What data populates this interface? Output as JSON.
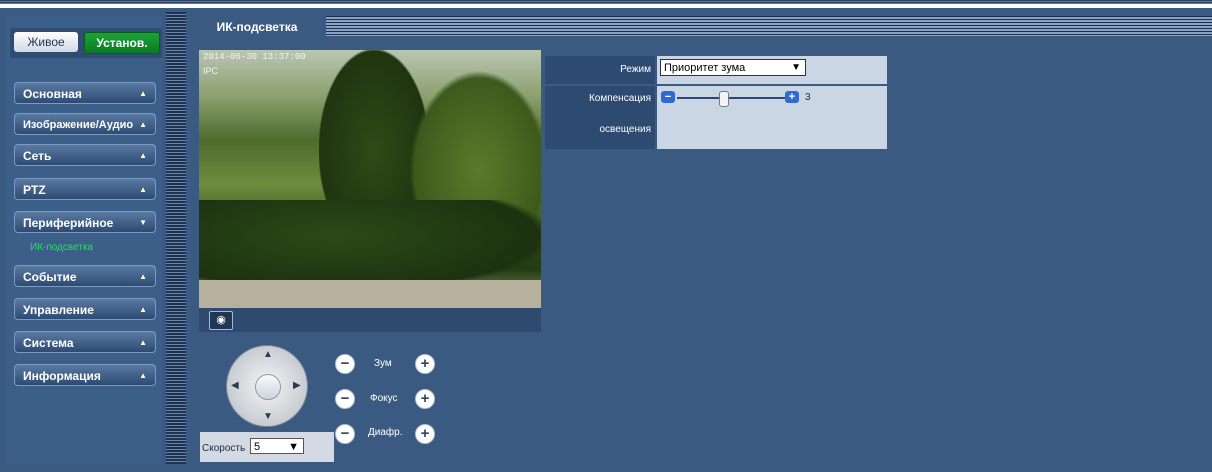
{
  "top_modes": {
    "live_label": "Живое",
    "setup_label": "Установ."
  },
  "sidebar": {
    "items": [
      {
        "label": "Основная",
        "arrow": "▲"
      },
      {
        "label": "Изображение/Аудио",
        "arrow": "▲"
      },
      {
        "label": "Сеть",
        "arrow": "▲"
      },
      {
        "label": "PTZ",
        "arrow": "▲"
      },
      {
        "label": "Периферийное",
        "arrow": "▼"
      },
      {
        "label": "Событие",
        "arrow": "▲"
      },
      {
        "label": "Управление",
        "arrow": "▲"
      },
      {
        "label": "Система",
        "arrow": "▲"
      },
      {
        "label": "Информация",
        "arrow": "▲"
      }
    ],
    "submenu_active": "ИК-подсветка"
  },
  "tab": {
    "label": "ИК-подсветка"
  },
  "video": {
    "osd_datetime": "2014-06-30 13:37:00",
    "osd_name": "IPC",
    "snapshot_icon": "camera-icon"
  },
  "ptz": {
    "zoom_label": "Зум",
    "focus_label": "Фокус",
    "iris_label": "Диафр.",
    "speed_label": "Скорость",
    "speed_value": "5",
    "minus_symbol": "−",
    "plus_symbol": "+"
  },
  "settings": {
    "mode_label": "Режим",
    "mode_value": "Приоритет зума",
    "compensation_label_1": "Компенсация",
    "compensation_label_2": "освещения",
    "compensation_value": "3",
    "minus_symbol": "−",
    "plus_symbol": "+"
  },
  "colors": {
    "background": "#3a5a82",
    "accent_green": "#1aa33a",
    "submenu_green": "#22e05a"
  }
}
